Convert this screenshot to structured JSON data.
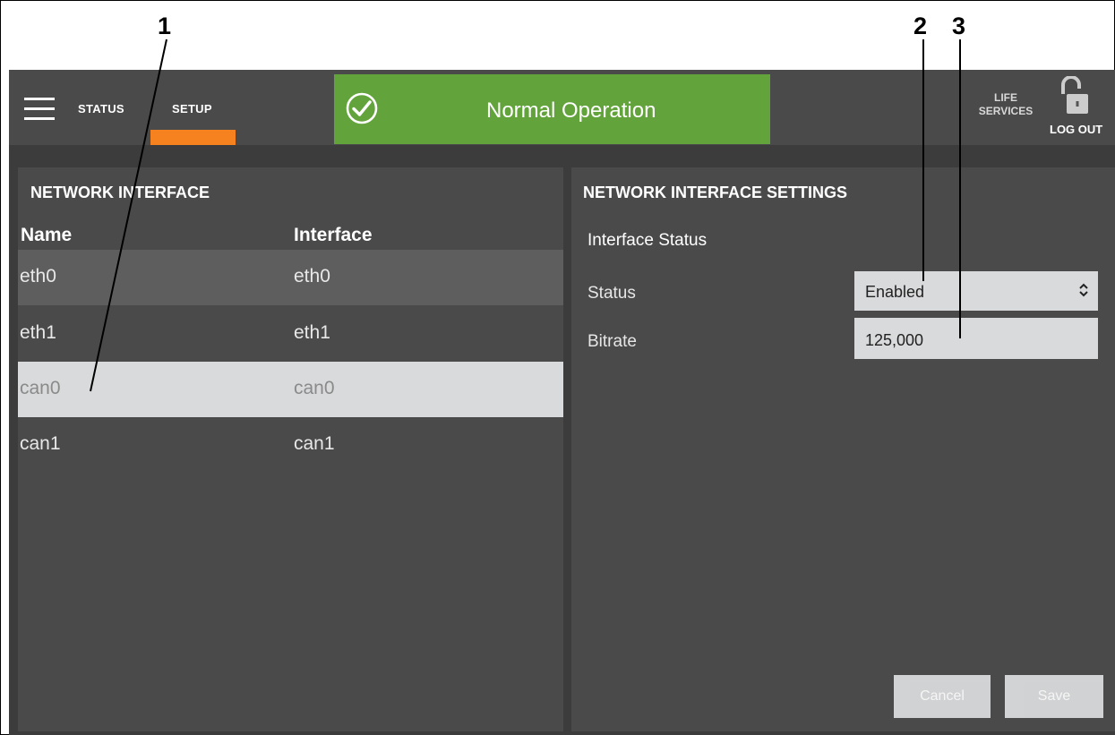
{
  "callouts": [
    "1",
    "2",
    "3"
  ],
  "header": {
    "nav_status": "STATUS",
    "nav_setup": "SETUP",
    "banner_text": "Normal Operation",
    "life_services_line1": "LIFE",
    "life_services_line2": "SERVICES",
    "logout": "LOG OUT"
  },
  "left_panel": {
    "title": "NETWORK INTERFACE",
    "columns": [
      "Name",
      "Interface"
    ],
    "rows": [
      {
        "name": "eth0",
        "interface": "eth0"
      },
      {
        "name": "eth1",
        "interface": "eth1"
      },
      {
        "name": "can0",
        "interface": "can0"
      },
      {
        "name": "can1",
        "interface": "can1"
      }
    ]
  },
  "right_panel": {
    "title": "NETWORK INTERFACE SETTINGS",
    "section": "Interface Status",
    "status_label": "Status",
    "status_value": "Enabled",
    "bitrate_label": "Bitrate",
    "bitrate_value": "125,000",
    "cancel_label": "Cancel",
    "save_label": "Save"
  },
  "colors": {
    "accent": "#f5821f",
    "banner": "#63a33c",
    "panel": "#4a4a4a",
    "selected_row": "#d9dadb"
  },
  "icons": [
    "hamburger-menu-icon",
    "check-circle-icon",
    "unlocked-padlock-icon",
    "up-down-chevron-icon"
  ]
}
